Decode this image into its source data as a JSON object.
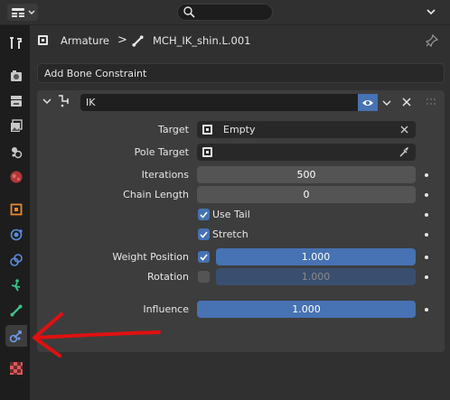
{
  "topbar": {
    "search_placeholder": ""
  },
  "header": {
    "object_name": "Armature",
    "separator": ">",
    "bone_name": "MCH_IK_shin.L.001"
  },
  "add_constraint": {
    "label": "Add Bone Constraint"
  },
  "constraint": {
    "name": "IK",
    "target": {
      "label": "Target",
      "value": "Empty"
    },
    "pole_target": {
      "label": "Pole Target",
      "value": ""
    },
    "iterations": {
      "label": "Iterations",
      "value": "500"
    },
    "chain_length": {
      "label": "Chain Length",
      "value": "0"
    },
    "use_tail": {
      "label": "Use Tail",
      "checked": true
    },
    "stretch": {
      "label": "Stretch",
      "checked": true
    },
    "weight_position": {
      "label": "Weight Position",
      "checked": true,
      "value": "1.000"
    },
    "rotation": {
      "label": "Rotation",
      "checked": false,
      "value": "1.000"
    },
    "influence": {
      "label": "Influence",
      "value": "1.000"
    }
  },
  "colors": {
    "accent": "#4772b3",
    "panel": "#3d3d3d",
    "annotation_arrow": "#e01010"
  }
}
